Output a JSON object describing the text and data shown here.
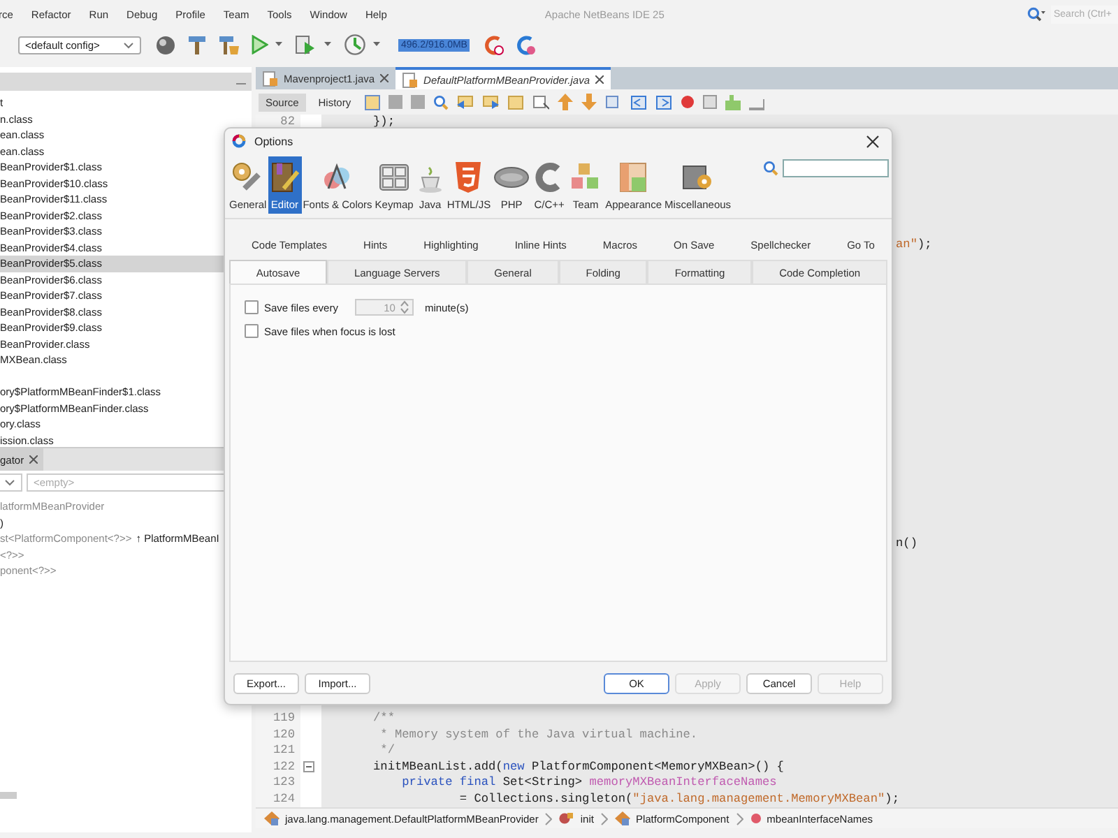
{
  "menu_bar": {
    "items": [
      "rce",
      "Refactor",
      "Run",
      "Debug",
      "Profile",
      "Team",
      "Tools",
      "Window",
      "Help"
    ],
    "title": "Apache NetBeans IDE 25",
    "search": {
      "placeholder": "Search (Ctrl+"
    }
  },
  "toolbar": {
    "config": "<default config>",
    "memory": "496.2/916.0MB"
  },
  "projects": {
    "items": [
      {
        "label": "t",
        "selected": false
      },
      {
        "label": "n.class",
        "selected": false
      },
      {
        "label": "ean.class",
        "selected": false
      },
      {
        "label": "ean.class",
        "selected": false
      },
      {
        "label": "BeanProvider$1.class",
        "selected": false
      },
      {
        "label": "BeanProvider$10.class",
        "selected": false
      },
      {
        "label": "BeanProvider$11.class",
        "selected": false
      },
      {
        "label": "BeanProvider$2.class",
        "selected": false
      },
      {
        "label": "BeanProvider$3.class",
        "selected": false
      },
      {
        "label": "BeanProvider$4.class",
        "selected": false
      },
      {
        "label": "BeanProvider$5.class",
        "selected": true
      },
      {
        "label": "BeanProvider$6.class",
        "selected": false
      },
      {
        "label": "BeanProvider$7.class",
        "selected": false
      },
      {
        "label": "BeanProvider$8.class",
        "selected": false
      },
      {
        "label": "BeanProvider$9.class",
        "selected": false
      },
      {
        "label": "BeanProvider.class",
        "selected": false
      },
      {
        "label": "MXBean.class",
        "selected": false
      },
      {
        "label": "ory$PlatformMBeanFinder$1.class",
        "selected": false
      },
      {
        "label": "ory$PlatformMBeanFinder.class",
        "selected": false
      },
      {
        "label": "ory.class",
        "selected": false
      },
      {
        "label": "ission.class",
        "selected": false
      }
    ]
  },
  "navigator": {
    "title": "gator",
    "filter": "<empty>",
    "members": [
      {
        "text": "latformMBeanProvider",
        "muted": true
      },
      {
        "text": ")",
        "muted": false
      },
      {
        "text": "st<PlatformComponent<?>>",
        "muted": true,
        "inherited": "↑ PlatformMBeanI"
      },
      {
        "text": "<?>>",
        "muted": true
      },
      {
        "text": "ponent<?>>",
        "muted": true
      }
    ]
  },
  "editor": {
    "tabs": [
      {
        "label": "Mavenproject1.java",
        "selected": false
      },
      {
        "label": "DefaultPlatformMBeanProvider.java",
        "selected": true
      }
    ],
    "views": [
      {
        "label": "Source",
        "selected": true
      },
      {
        "label": "History",
        "selected": false
      }
    ],
    "top_lines": [
      {
        "number": "82",
        "collapsible": false,
        "tokens": [
          {
            "text": "});",
            "kind": "plain"
          }
        ]
      }
    ],
    "fragments": [
      {
        "tokens": [
          {
            "text": "an\"",
            "kind": "string"
          },
          {
            "text": ");",
            "kind": "plain"
          }
        ]
      },
      {
        "tokens": [
          {
            "text": "n()",
            "kind": "plain"
          }
        ]
      }
    ],
    "bottom_lines": [
      {
        "number": "119",
        "collapsible": false,
        "tokens": [
          {
            "text": "/**",
            "kind": "comment"
          }
        ]
      },
      {
        "number": "120",
        "collapsible": false,
        "tokens": [
          {
            "text": " * Memory system of the Java virtual machine.",
            "kind": "comment"
          }
        ]
      },
      {
        "number": "121",
        "collapsible": false,
        "tokens": [
          {
            "text": " */",
            "kind": "comment"
          }
        ]
      },
      {
        "number": "122",
        "collapsible": true,
        "tokens": [
          {
            "text": "initMBeanList.add(",
            "kind": "plain"
          },
          {
            "text": "new",
            "kind": "keyword"
          },
          {
            "text": " PlatformComponent<MemoryMXBean>() {",
            "kind": "plain"
          }
        ]
      },
      {
        "number": "123",
        "collapsible": false,
        "tokens": [
          {
            "text": "    private final",
            "kind": "keyword"
          },
          {
            "text": " Set<String> ",
            "kind": "plain"
          },
          {
            "text": "memoryMXBeanInterfaceNames",
            "kind": "field"
          }
        ]
      },
      {
        "number": "124",
        "collapsible": false,
        "tokens": [
          {
            "text": "            = Collections.singleton(",
            "kind": "plain"
          },
          {
            "text": "\"java.lang.management.MemoryMXBean\"",
            "kind": "string"
          },
          {
            "text": ");",
            "kind": "plain"
          }
        ]
      }
    ],
    "breadcrumbs": [
      {
        "label": "java.lang.management.DefaultPlatformMBeanProvider",
        "kind": "class"
      },
      {
        "label": "init",
        "kind": "method"
      },
      {
        "label": "PlatformComponent",
        "kind": "class"
      },
      {
        "label": "mbeanInterfaceNames",
        "kind": "field"
      }
    ]
  },
  "dialog": {
    "title": "Options",
    "categories": [
      {
        "label": "General",
        "kind": "general",
        "selected": false
      },
      {
        "label": "Editor",
        "kind": "editor",
        "selected": true
      },
      {
        "label": "Fonts & Colors",
        "kind": "fonts",
        "selected": false
      },
      {
        "label": "Keymap",
        "kind": "keymap",
        "selected": false
      },
      {
        "label": "Java",
        "kind": "java",
        "selected": false
      },
      {
        "label": "HTML/JS",
        "kind": "html",
        "selected": false
      },
      {
        "label": "PHP",
        "kind": "php",
        "selected": false
      },
      {
        "label": "C/C++",
        "kind": "cpp",
        "selected": false
      },
      {
        "label": "Team",
        "kind": "team",
        "selected": false
      },
      {
        "label": "Appearance",
        "kind": "appearance",
        "selected": false
      },
      {
        "label": "Miscellaneous",
        "kind": "misc",
        "selected": false
      }
    ],
    "tab_rows": [
      [
        {
          "label": "Code Templates",
          "selected": false
        },
        {
          "label": "Hints",
          "selected": false
        },
        {
          "label": "Highlighting",
          "selected": false
        },
        {
          "label": "Inline Hints",
          "selected": false
        },
        {
          "label": "Macros",
          "selected": false
        },
        {
          "label": "On Save",
          "selected": false
        },
        {
          "label": "Spellchecker",
          "selected": false
        },
        {
          "label": "Go To",
          "selected": false
        }
      ],
      [
        {
          "label": "Autosave",
          "selected": true
        },
        {
          "label": "Language Servers",
          "selected": false
        },
        {
          "label": "General",
          "selected": false
        },
        {
          "label": "Folding",
          "selected": false
        },
        {
          "label": "Formatting",
          "selected": false
        },
        {
          "label": "Code Completion",
          "selected": false
        }
      ]
    ],
    "options": [
      {
        "label": "Save files every",
        "checked": false,
        "spinner": {
          "value": "10",
          "disabled": true,
          "unit": "minute(s)"
        }
      },
      {
        "label": "Save files when focus is lost",
        "checked": false
      }
    ],
    "left_buttons": [
      {
        "label": "Export...",
        "default": false,
        "disabled": false
      },
      {
        "label": "Import...",
        "default": false,
        "disabled": false
      }
    ],
    "right_buttons": [
      {
        "label": "OK",
        "default": true,
        "disabled": false
      },
      {
        "label": "Apply",
        "default": false,
        "disabled": true
      },
      {
        "label": "Cancel",
        "default": false,
        "disabled": false
      },
      {
        "label": "Help",
        "default": false,
        "disabled": true
      }
    ]
  }
}
